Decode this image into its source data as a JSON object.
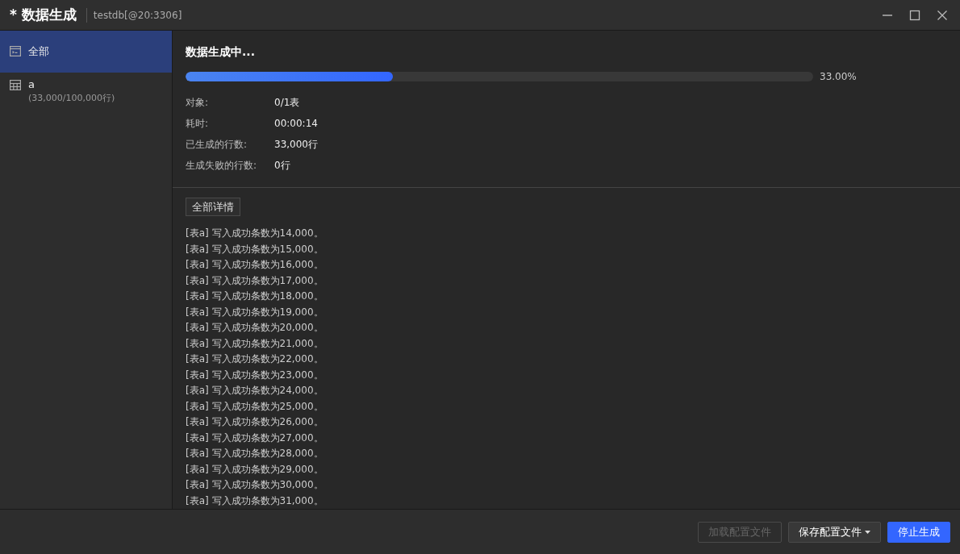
{
  "window": {
    "title": "* 数据生成",
    "subtitle": "testdb[@20:3306]"
  },
  "sidebar": {
    "items": [
      {
        "kind": "all",
        "label": "全部",
        "selected": true
      },
      {
        "kind": "table",
        "label": "a",
        "detail": "(33,000/100,000行)",
        "selected": false
      }
    ]
  },
  "progress": {
    "title": "数据生成中...",
    "level": 0.33,
    "reading": "33.00%"
  },
  "stats": [
    {
      "label": "对象:",
      "value": "0/1表"
    },
    {
      "label": "耗时:",
      "value": "00:00:14"
    },
    {
      "label": "已生成的行数:",
      "value": "33,000行"
    },
    {
      "label": "生成失败的行数:",
      "value": "0行"
    }
  ],
  "log": {
    "button": "全部详情",
    "lines": [
      "[表a] 写入成功条数为14,000。",
      "[表a] 写入成功条数为15,000。",
      "[表a] 写入成功条数为16,000。",
      "[表a] 写入成功条数为17,000。",
      "[表a] 写入成功条数为18,000。",
      "[表a] 写入成功条数为19,000。",
      "[表a] 写入成功条数为20,000。",
      "[表a] 写入成功条数为21,000。",
      "[表a] 写入成功条数为22,000。",
      "[表a] 写入成功条数为23,000。",
      "[表a] 写入成功条数为24,000。",
      "[表a] 写入成功条数为25,000。",
      "[表a] 写入成功条数为26,000。",
      "[表a] 写入成功条数为27,000。",
      "[表a] 写入成功条数为28,000。",
      "[表a] 写入成功条数为29,000。",
      "[表a] 写入成功条数为30,000。",
      "[表a] 写入成功条数为31,000。"
    ]
  },
  "footer": {
    "buttons": [
      {
        "kind": "plain",
        "label": "加载配置文件",
        "disabled": true
      },
      {
        "kind": "dropdown",
        "label": "保存配置文件",
        "disabled": false
      },
      {
        "kind": "primary",
        "label": "停止生成",
        "disabled": false
      }
    ]
  }
}
